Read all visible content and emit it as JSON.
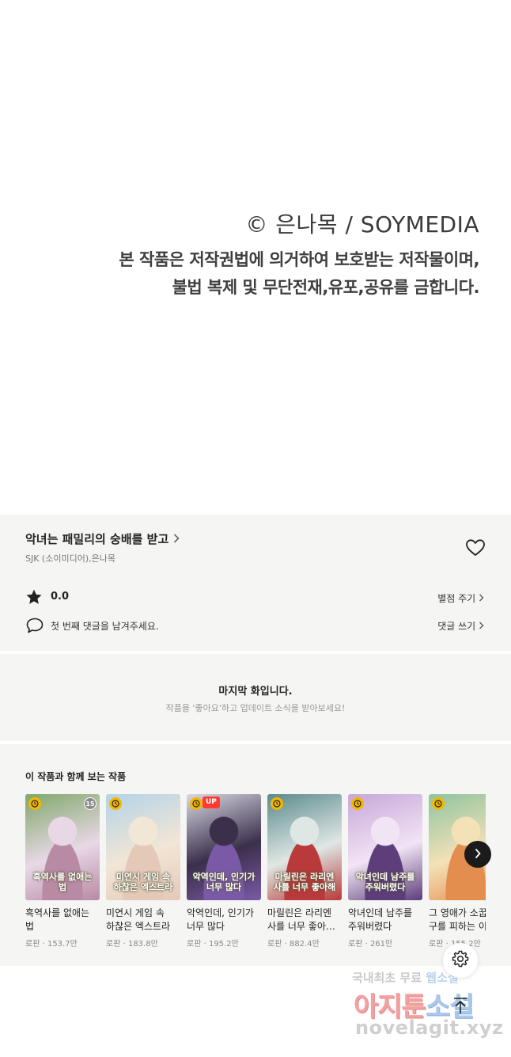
{
  "notice": {
    "copyright": "© 은나목 / SOYMEDIA",
    "line1": "본 작품은 저작권법에 의거하여 보호받는 저작물이며,",
    "line2": "불법 복제 및 무단전재,유포,공유를 금합니다."
  },
  "work": {
    "title": "악녀는 패밀리의 숭배를 받고",
    "authors": "SJK (소이미디어),은나목",
    "score": "0.0",
    "rate_label": "별점 주기",
    "comment_hint": "첫 번째 댓글을 남겨주세요.",
    "comment_label": "댓글 쓰기"
  },
  "last_episode": {
    "title": "마지막 화입니다.",
    "subtitle": "작품을 '좋아요'하고 업데이트 소식을 받아보세요!"
  },
  "recommendations": {
    "heading": "이 작품과 함께 보는 작품",
    "items": [
      {
        "title": "흑역사를 없애는 법",
        "genre": "로판",
        "views": "153.7만",
        "badge": "clock",
        "age": "15",
        "cover_text": "흑역사를 없애는 법",
        "colors": [
          "#7fa86a",
          "#b88aa4",
          "#e8d8e6"
        ]
      },
      {
        "title": "미연시 게임 속 하찮은 엑스트라",
        "genre": "로판",
        "views": "183.8만",
        "badge": "clock",
        "age": "",
        "cover_text": "미연시 게임 속 하찮은 엑스트라",
        "colors": [
          "#b3d3e8",
          "#e4c9b8",
          "#f2e6d6"
        ]
      },
      {
        "title": "악역인데, 인기가 너무 많다",
        "genre": "로판",
        "views": "195.2만",
        "badge": "up",
        "age": "",
        "cover_text": "악역인데, 인기가 너무 많다",
        "colors": [
          "#d9d9e3",
          "#7a5aa6",
          "#3b2f4c"
        ]
      },
      {
        "title": "마릴린은 라리엔 사를 너무 좋아…",
        "genre": "로판",
        "views": "882.4만",
        "badge": "clock",
        "age": "",
        "cover_text": "마릴린은 라리엔사를 너무 좋아해",
        "colors": [
          "#5b8a8c",
          "#b83a3a",
          "#dfe7e4"
        ]
      },
      {
        "title": "악녀인데 남주를 주워버렸다",
        "genre": "로판",
        "views": "261만",
        "badge": "clock",
        "age": "",
        "cover_text": "악녀인데 남주를 주워버렸다",
        "colors": [
          "#c7a6d9",
          "#5d3d7a",
          "#f1e4f4"
        ]
      },
      {
        "title": "그 영애가 소꿉 구를 피하는 이",
        "genre": "로판",
        "views": "155.2만",
        "badge": "clock",
        "age": "",
        "cover_text": "",
        "colors": [
          "#8fc4a0",
          "#e38d4e",
          "#f4e1b8"
        ]
      }
    ]
  },
  "icons": {
    "title_chevron": "chevron-right-icon",
    "like": "heart-icon",
    "rating": "star-icon",
    "comment": "speech-bubble-icon",
    "badge_clock": "clock-icon",
    "badge_up": "UP",
    "next": "chevron-right-icon",
    "settings": "gear-icon",
    "top": "arrow-up-icon"
  },
  "watermark": {
    "line1_a": "국내최초 무료",
    "line1_b": "웹소설",
    "line2_a": "아지툰",
    "line2_b": "소설",
    "line3": "novelagit.xyz"
  },
  "colors": {
    "panel_bg": "#f5f5f4",
    "badge_clock": "#f3b700",
    "badge_up": "#ff3b30",
    "text_muted": "#888888"
  }
}
